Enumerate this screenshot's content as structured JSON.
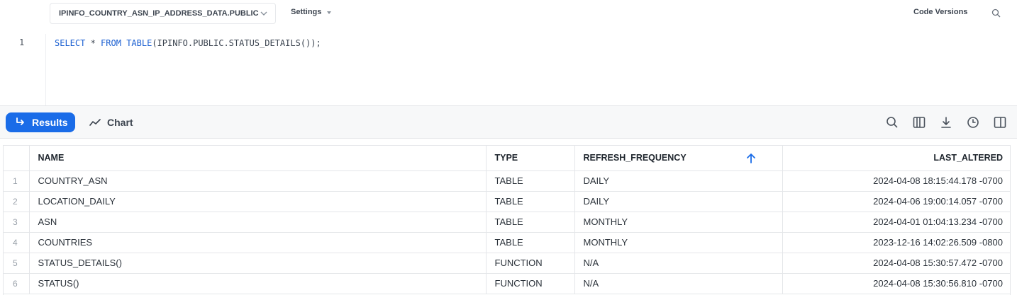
{
  "toolbar": {
    "context": "IPINFO_COUNTRY_ASN_IP_ADDRESS_DATA.PUBLIC",
    "settings": "Settings",
    "code_versions": "Code Versions"
  },
  "editor": {
    "line_number": "1",
    "tokens": [
      "SELECT",
      " * ",
      "FROM",
      " ",
      "TABLE",
      "(IPINFO.PUBLIC.STATUS_DETAILS());"
    ]
  },
  "results_bar": {
    "results_label": "Results",
    "chart_label": "Chart",
    "icons": [
      "search-icon",
      "columns-icon",
      "download-icon",
      "history-icon",
      "panel-icon"
    ]
  },
  "table": {
    "columns": [
      "NAME",
      "TYPE",
      "REFRESH_FREQUENCY",
      "LAST_ALTERED"
    ],
    "sort_column": "REFRESH_FREQUENCY",
    "rows": [
      [
        "1",
        "COUNTRY_ASN",
        "TABLE",
        "DAILY",
        "2024-04-08 18:15:44.178 -0700"
      ],
      [
        "2",
        "LOCATION_DAILY",
        "TABLE",
        "DAILY",
        "2024-04-06 19:00:14.057 -0700"
      ],
      [
        "3",
        "ASN",
        "TABLE",
        "MONTHLY",
        "2024-04-01 01:04:13.234 -0700"
      ],
      [
        "4",
        "COUNTRIES",
        "TABLE",
        "MONTHLY",
        "2023-12-16 14:02:26.509 -0800"
      ],
      [
        "5",
        "STATUS_DETAILS()",
        "FUNCTION",
        "N/A",
        "2024-04-08 15:30:57.472 -0700"
      ],
      [
        "6",
        "STATUS()",
        "FUNCTION",
        "N/A",
        "2024-04-08 15:30:56.810 -0700"
      ]
    ]
  },
  "colors": {
    "accent": "#1a6ce8",
    "keyword": "#1a5fd1"
  }
}
